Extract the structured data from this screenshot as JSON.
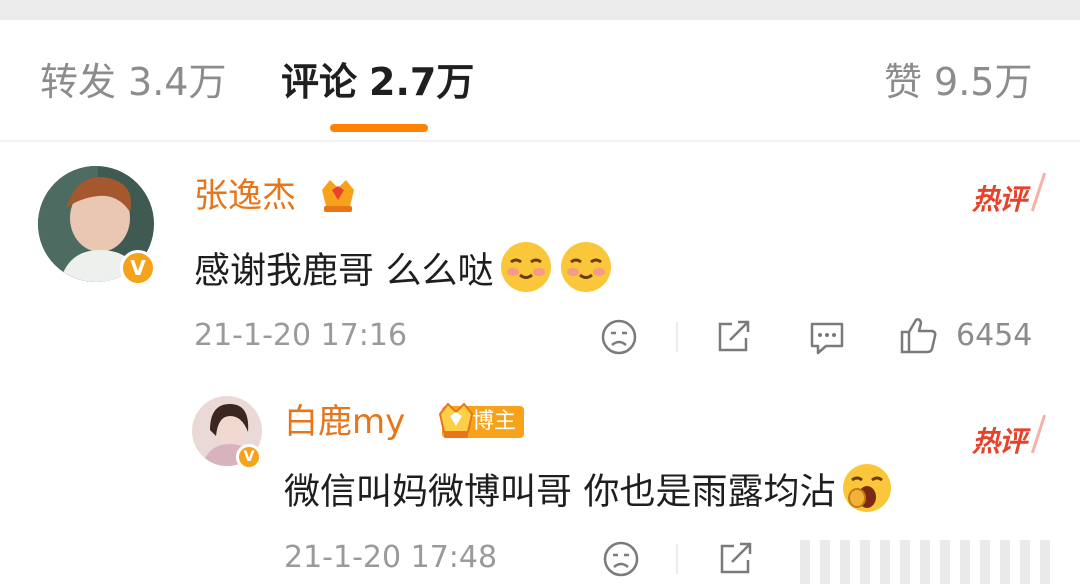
{
  "tabs": {
    "repost": {
      "label": "转发",
      "count": "3.4万"
    },
    "comments": {
      "label": "评论",
      "count": "2.7万"
    },
    "likes": {
      "label": "赞",
      "count": "9.5万"
    }
  },
  "comments": [
    {
      "username": "张逸杰",
      "text": "感谢我鹿哥 么么哒",
      "hot_label": "热评",
      "timestamp": "21-1-20 17:16",
      "like_count": "6454",
      "verified_badge": "V",
      "icons": [
        "dislike-face-icon",
        "share-icon",
        "comment-icon",
        "thumbs-up-icon"
      ]
    },
    {
      "username": "白鹿my",
      "badge": "博主",
      "text": "微信叫妈微博叫哥 你也是雨露均沾",
      "hot_label": "热评",
      "timestamp": "21-1-20 17:48",
      "verified_badge": "V",
      "icons": [
        "dislike-face-icon",
        "share-icon"
      ]
    }
  ],
  "colors": {
    "accent": "#ff8200",
    "username": "#e8751a",
    "hot": "#e6432b",
    "meta": "#9a9a9a"
  }
}
